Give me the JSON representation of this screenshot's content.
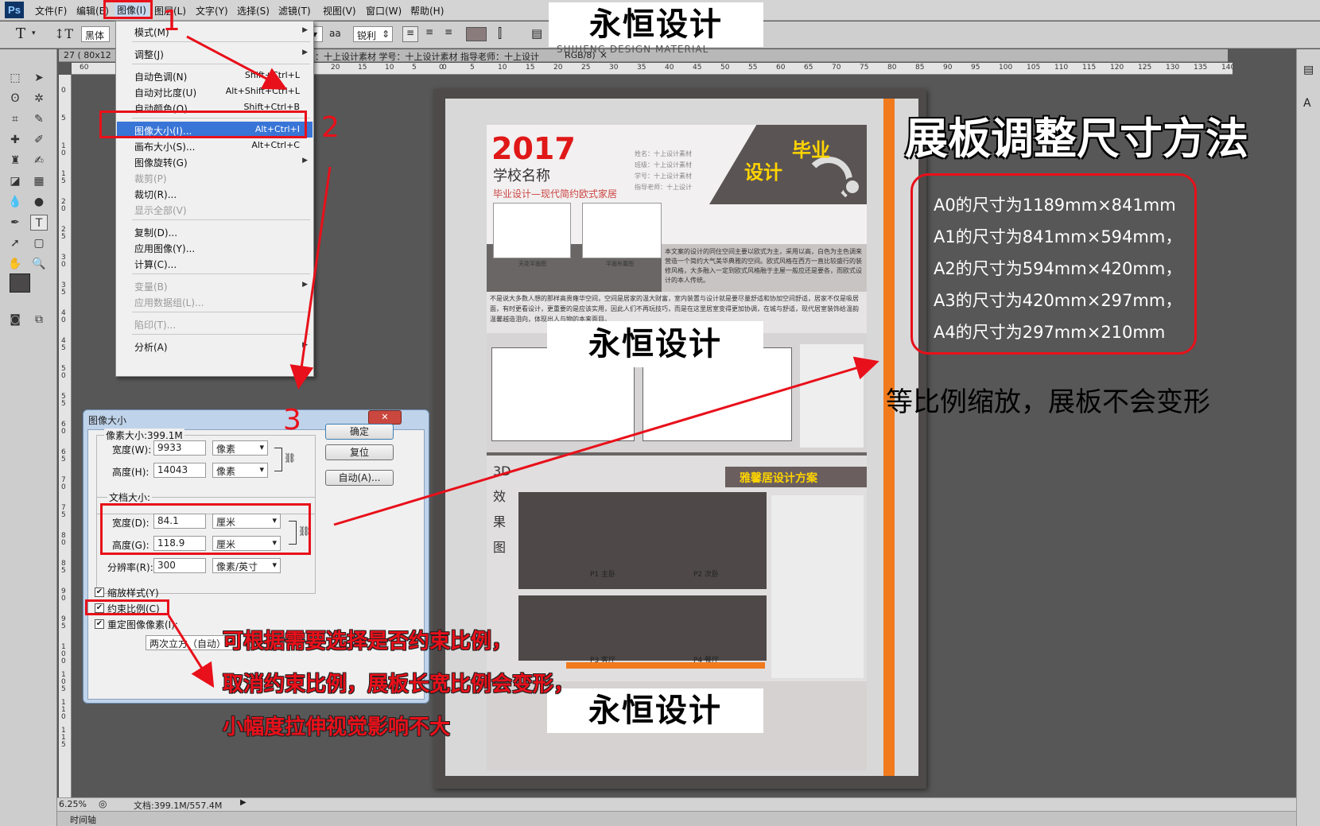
{
  "app": {
    "logo": "Ps"
  },
  "menubar": [
    "文件(F)",
    "编辑(E)",
    "图像(I)",
    "图层(L)",
    "文字(Y)",
    "选择(S)",
    "滤镜(T)",
    "视图(V)",
    "窗口(W)",
    "帮助(H)"
  ],
  "options_bar": {
    "tool_glyph": "T",
    "font_family": "黑体",
    "aa_label": "aa",
    "aa_mode": "锐利"
  },
  "document": {
    "tab_title": "27 ( 80x12",
    "tab_info": "班级：十上设计素材 学号：十上设计素材 指导老师：十上设计",
    "tab_mode": "RGB/8)",
    "close": "×"
  },
  "ruler_h": [
    "60",
    "0",
    "5",
    "10",
    "15",
    "20",
    "25",
    "30",
    "35",
    "40",
    "45",
    "50",
    "55",
    "60",
    "65",
    "70",
    "75",
    "80",
    "85",
    "90",
    "95",
    "100",
    "105",
    "110",
    "115",
    "120",
    "125",
    "130",
    "135",
    "140"
  ],
  "ruler_h_left": [
    "20",
    "15",
    "10",
    "5",
    "0"
  ],
  "ruler_v": [
    "0",
    "5",
    "1 0",
    "1 5",
    "2 0",
    "2 5",
    "3 0",
    "3 5",
    "4 0",
    "4 5",
    "5 0",
    "5 5",
    "6 0",
    "6 5",
    "7 0",
    "7 5",
    "8 0",
    "8 5",
    "9 0",
    "9 5",
    "1 0 0",
    "1 0 5",
    "1 1 0",
    "1 1 5"
  ],
  "image_menu": {
    "items": [
      {
        "label": "模式(M)",
        "shortcut": "",
        "submenu": true,
        "disabled": false
      },
      {
        "sep": true
      },
      {
        "label": "调整(J)",
        "shortcut": "",
        "submenu": true,
        "disabled": false
      },
      {
        "sep": true
      },
      {
        "label": "自动色调(N)",
        "shortcut": "Shift+Ctrl+L",
        "disabled": false
      },
      {
        "label": "自动对比度(U)",
        "shortcut": "Alt+Shift+Ctrl+L",
        "disabled": false
      },
      {
        "label": "自动颜色(O)",
        "shortcut": "Shift+Ctrl+B",
        "disabled": false
      },
      {
        "sep": true
      },
      {
        "label": "图像大小(I)...",
        "shortcut": "Alt+Ctrl+I",
        "highlight": true
      },
      {
        "label": "画布大小(S)...",
        "shortcut": "Alt+Ctrl+C",
        "disabled": false
      },
      {
        "label": "图像旋转(G)",
        "shortcut": "",
        "submenu": true,
        "disabled": false
      },
      {
        "label": "裁剪(P)",
        "shortcut": "",
        "disabled": true
      },
      {
        "label": "裁切(R)...",
        "shortcut": "",
        "disabled": false
      },
      {
        "label": "显示全部(V)",
        "shortcut": "",
        "disabled": true
      },
      {
        "sep": true
      },
      {
        "label": "复制(D)...",
        "shortcut": "",
        "disabled": false
      },
      {
        "label": "应用图像(Y)...",
        "shortcut": "",
        "disabled": false
      },
      {
        "label": "计算(C)...",
        "shortcut": "",
        "disabled": false
      },
      {
        "sep": true
      },
      {
        "label": "变量(B)",
        "shortcut": "",
        "submenu": true,
        "disabled": true
      },
      {
        "label": "应用数据组(L)...",
        "shortcut": "",
        "disabled": true
      },
      {
        "sep": true
      },
      {
        "label": "陷印(T)...",
        "shortcut": "",
        "disabled": true
      },
      {
        "sep": true
      },
      {
        "label": "分析(A)",
        "shortcut": "",
        "submenu": true,
        "disabled": false
      }
    ]
  },
  "dialog": {
    "title": "图像大小",
    "close": "✕",
    "pixel_group": "像素大小:399.1M",
    "width_label": "宽度(W):",
    "width_value": "9933",
    "width_unit": "像素",
    "height_label": "高度(H):",
    "height_value": "14043",
    "height_unit": "像素",
    "doc_group": "文档大小:",
    "doc_width_label": "宽度(D):",
    "doc_width_value": "84.1",
    "doc_width_unit": "厘米",
    "doc_height_label": "高度(G):",
    "doc_height_value": "118.9",
    "doc_height_unit": "厘米",
    "res_label": "分辨率(R):",
    "res_value": "300",
    "res_unit": "像素/英寸",
    "scale_styles": "缩放样式(Y)",
    "constrain": "约束比例(C)",
    "resample": "重定图像像素(I):",
    "resample_method": "两次立方（自动）",
    "ok": "确定",
    "reset": "复位",
    "auto": "自动(A)..."
  },
  "status": {
    "zoom": "6.25%",
    "doc": "文档:399.1M/557.4M",
    "timeline": "时间轴"
  },
  "board": {
    "year": "2017",
    "school": "学校名称",
    "subtitle": "毕业设计—现代简约欧式家居",
    "grad": [
      "毕业",
      "设计"
    ],
    "info": [
      "姓名：十上设计素材",
      "班级：十上设计素材",
      "学号：十上设计素材",
      "指导老师：十上设计"
    ],
    "plan_captions": [
      "天花平面图",
      "平面布置图"
    ],
    "intro": "本文案的设计的同住空间主要以欧式为主，采用以高，白色为主色调来营造一个简约大气美华典雅的空间。欧式风格在西方一直比较盛行的装修风格，大多融入一定到欧式风格融于主屋一般应还是要各，而欧式设计的本人传统。",
    "body": "不是说大多数人想的那样高贵雍华空间，空间是居家的温大财富，室内装置与设计就是要尽量舒适和协加空间舒适，居家不仅是吸居面，有时更看设计，更重要的是应该实用，因此人们不再玩技巧，而是在这里居室变得更加协调，在城与舒适，现代居室装饰给温韵温馨越造泪向，体现出人与物的本来面目。",
    "section3_title": "雅馨居设计方案",
    "render_label": [
      "3D",
      "效",
      "果",
      "图"
    ],
    "render_captions": [
      "P1 主卧",
      "P2 次卧",
      "P3 客厅",
      "P4 餐厅"
    ]
  },
  "watermarks": [
    "永恒设计",
    "永恒设计",
    "永恒设计"
  ],
  "watermark_sub": "SHIHENG DESIGN MATERIAL",
  "annotations": {
    "steps": [
      "1",
      "2",
      "3"
    ],
    "headline": "展板调整尺寸方法",
    "sizes": [
      "A0的尺寸为1189mm×841mm",
      "A1的尺寸为841mm×594mm，",
      "A2的尺寸为594mm×420mm，",
      "A3的尺寸为420mm×297mm，",
      "A4的尺寸为297mm×210mm"
    ],
    "scale_note": "等比例缩放，展板不会变形",
    "tips": [
      "可根据需要选择是否约束比例，",
      "取消约束比例，展板长宽比例会变形，",
      "小幅度拉伸视觉影响不大"
    ]
  },
  "colors": {
    "accent_red": "#e8101a",
    "orange": "#f07a1c",
    "board_dark": "#4e4a4a",
    "highlight": "#3875d7"
  }
}
